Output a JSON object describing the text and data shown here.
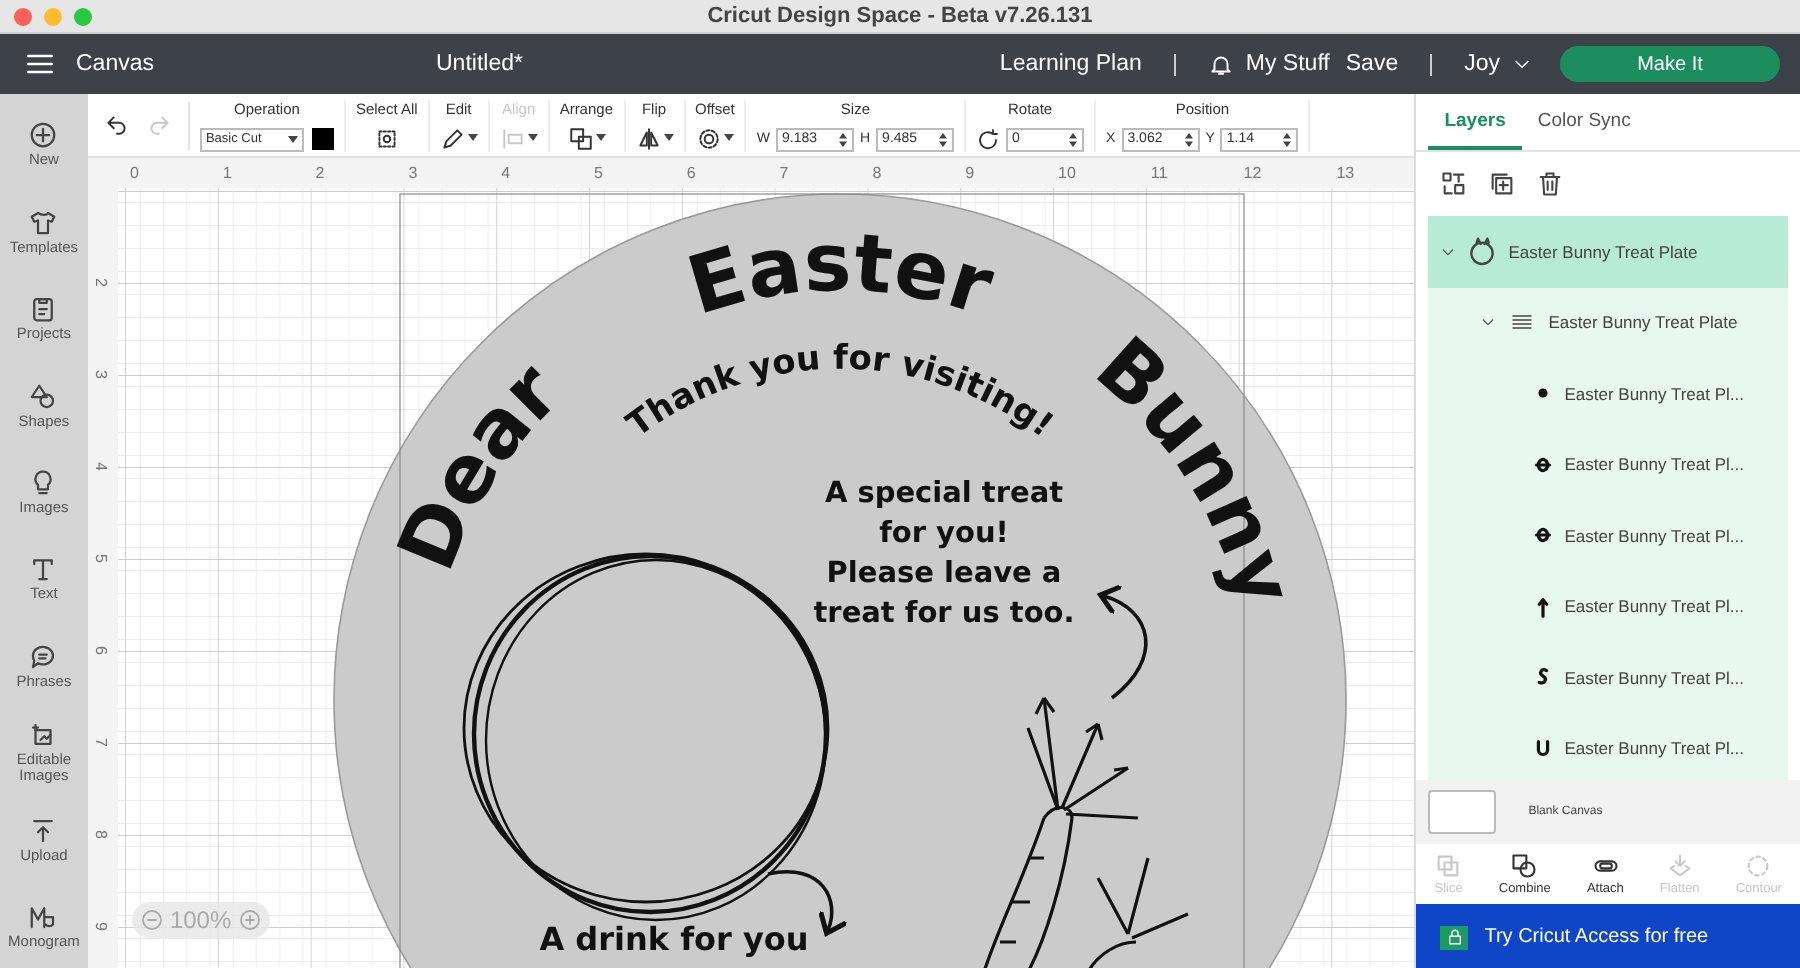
{
  "window": {
    "title": "Cricut Design Space - Beta v7.26.131"
  },
  "app_bar": {
    "section": "Canvas",
    "document": "Untitled*",
    "links": [
      "Learning Plan",
      "My Stuff",
      "Save"
    ],
    "user": "Joy",
    "action": "Make It"
  },
  "sidebar": {
    "items": [
      {
        "label": "New"
      },
      {
        "label": "Templates"
      },
      {
        "label": "Projects"
      },
      {
        "label": "Shapes"
      },
      {
        "label": "Images"
      },
      {
        "label": "Text"
      },
      {
        "label": "Phrases"
      },
      {
        "label": "Editable Images"
      },
      {
        "label": "Upload"
      },
      {
        "label": "Monogram"
      }
    ]
  },
  "history": [
    {
      "disabled": false
    },
    {
      "disabled": true
    }
  ],
  "toolbar": [
    {
      "kind": "select",
      "label": "Operation",
      "value": "Basic Cut",
      "disabled": false
    },
    {
      "kind": "icon",
      "label": "Select All",
      "disabled": false
    },
    {
      "kind": "icon",
      "label": "Edit",
      "disabled": false
    },
    {
      "kind": "icon",
      "label": "Align",
      "disabled": true
    },
    {
      "kind": "icon",
      "label": "Arrange",
      "disabled": false
    },
    {
      "kind": "icon",
      "label": "Flip",
      "disabled": false
    },
    {
      "kind": "icon",
      "label": "Offset",
      "disabled": false
    },
    {
      "kind": "fields",
      "label": "Size",
      "disabled": false,
      "fields": [
        {
          "prefix": "W",
          "value": "9.183"
        },
        {
          "prefix": "H",
          "value": "9.485"
        }
      ]
    },
    {
      "kind": "rotate",
      "label": "Rotate",
      "disabled": false,
      "fields": [
        {
          "value": "0"
        }
      ]
    },
    {
      "kind": "fields",
      "label": "Position",
      "disabled": false,
      "fields": [
        {
          "prefix": "X",
          "value": "3.062"
        },
        {
          "prefix": "Y",
          "value": "1.14"
        }
      ]
    }
  ],
  "rulers": {
    "horizontal": [
      "0",
      "1",
      "2",
      "3",
      "4",
      "5",
      "6",
      "7",
      "8",
      "9",
      "10",
      "11",
      "12",
      "13"
    ],
    "vertical": [
      "2",
      "3",
      "4",
      "5",
      "6",
      "7",
      "8",
      "9"
    ]
  },
  "design": {
    "title": [
      "Dear",
      "Easter",
      "Bunny"
    ],
    "subtitle": "Thank you for visiting!",
    "treat_note": [
      "A special treat",
      "for you!",
      "Please leave a",
      "treat for us too."
    ],
    "drink_note": "A drink for you"
  },
  "zoom": "100%",
  "panel": {
    "tabs": [
      {
        "label": "Layers",
        "selected": true
      },
      {
        "label": "Color Sync",
        "selected": false
      }
    ],
    "layers": [
      {
        "name": "Easter Bunny Treat Plate",
        "expanded": true,
        "selected": true,
        "children": [
          {
            "name": "Easter Bunny Treat Plate",
            "expanded": true,
            "selected": false,
            "children": [
              {
                "name": "Easter Bunny Treat Pl...",
                "selected": false
              },
              {
                "name": "Easter Bunny Treat Pl...",
                "selected": false
              },
              {
                "name": "Easter Bunny Treat Pl...",
                "selected": false
              },
              {
                "name": "Easter Bunny Treat Pl...",
                "selected": false
              },
              {
                "name": "Easter Bunny Treat Pl...",
                "selected": false
              },
              {
                "name": "Easter Bunny Treat Pl...",
                "selected": false
              }
            ]
          }
        ]
      }
    ],
    "blank_canvas": "Blank Canvas",
    "actions": [
      {
        "label": "Slice",
        "disabled": true
      },
      {
        "label": "Combine",
        "disabled": false
      },
      {
        "label": "Attach",
        "disabled": false
      },
      {
        "label": "Flatten",
        "disabled": true
      },
      {
        "label": "Contour",
        "disabled": true
      }
    ],
    "banner": "Try Cricut Access for free"
  }
}
